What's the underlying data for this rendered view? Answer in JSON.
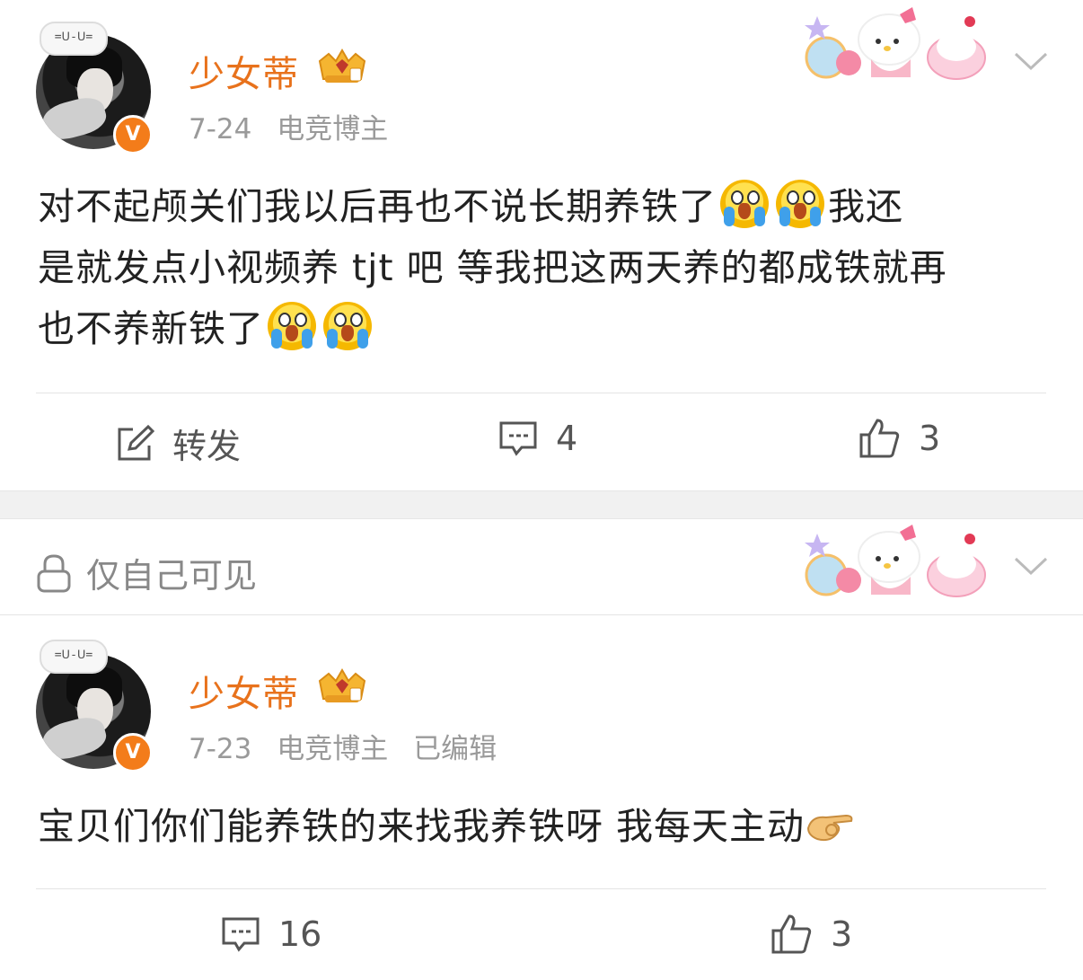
{
  "posts": [
    {
      "author": "少女蒂",
      "avatar_bubble": "=ᑌ-ᑌ=",
      "verified_badge": "V",
      "date": "7-24",
      "tag": "电竞博主",
      "edited": "",
      "text_lines": [
        "对不起颅关们我以后再也不说长期养铁了",
        "我还",
        "是就发点小视频养 tjt 吧 等我把这两天养的都成铁就再",
        "也不养新铁了"
      ],
      "actions": {
        "repost_label": "转发",
        "comments": "4",
        "likes": "3"
      }
    },
    {
      "visibility": "仅自己可见",
      "author": "少女蒂",
      "avatar_bubble": "=ᑌ-ᑌ=",
      "verified_badge": "V",
      "date": "7-23",
      "tag": "电竞博主",
      "edited": "已编辑",
      "text_lines": [
        "宝贝们你们能养铁的来找我养铁呀 我每天主动"
      ],
      "actions": {
        "comments": "16",
        "likes": "3"
      }
    }
  ],
  "icons": {
    "crying_emoji": "crying-face-emoji",
    "hand_emoji": "hooking-hand-emoji",
    "repost": "edit-icon",
    "comment": "comment-icon",
    "like": "thumbs-up-icon",
    "lock": "lock-icon",
    "chevron": "chevron-down-icon"
  },
  "colors": {
    "name": "#e8721c",
    "badge": "#f37c1a",
    "meta": "#9a9a9a",
    "background_gap": "#f1f1f1"
  }
}
